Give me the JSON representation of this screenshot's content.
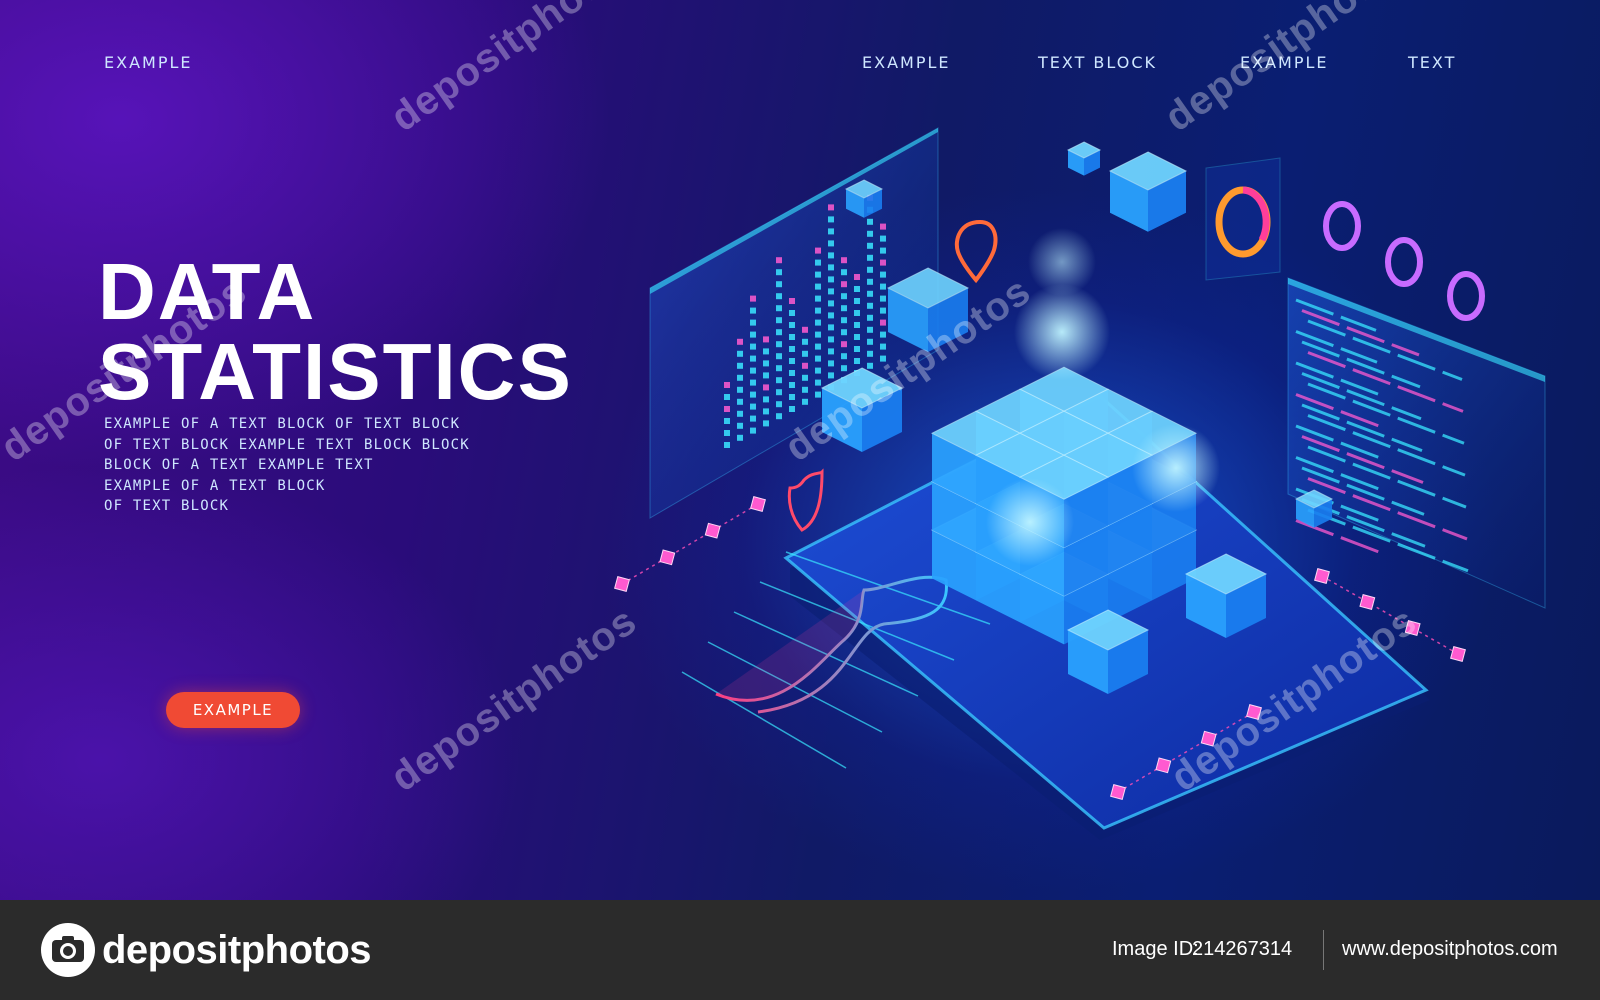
{
  "nav": {
    "left": "EXAMPLE",
    "items": [
      "EXAMPLE",
      "TEXT BLOCK",
      "EXAMPLE",
      "TEXT"
    ]
  },
  "hero": {
    "headline_line1": "DATA",
    "headline_line2": "STATISTICS",
    "body_lines": [
      "EXAMPLE  OF  A  TEXT  BLOCK  OF  TEXT  BLOCK",
      "OF  TEXT  BLOCK  EXAMPLE  TEXT  BLOCK  BLOCK",
      "BLOCK  OF  A  TEXT  EXAMPLE  TEXT",
      "EXAMPLE  OF  A  TEXT  BLOCK",
      "OF  TEXT  BLOCK"
    ],
    "cta_label": "EXAMPLE"
  },
  "watermark": {
    "text": "depositphotos"
  },
  "footer": {
    "brand": "depositphotos",
    "image_id_label": "Image ID:",
    "image_id_value": "214267314",
    "url": "www.depositphotos.com"
  },
  "colors": {
    "accent": "#f04a34",
    "cube": "#2fa8ff",
    "magenta": "#ff4fb8",
    "cyan": "#39e6ff"
  },
  "icons": [
    "camera-icon",
    "location-pin-icon",
    "shield-icon",
    "ring-chart-icon"
  ]
}
